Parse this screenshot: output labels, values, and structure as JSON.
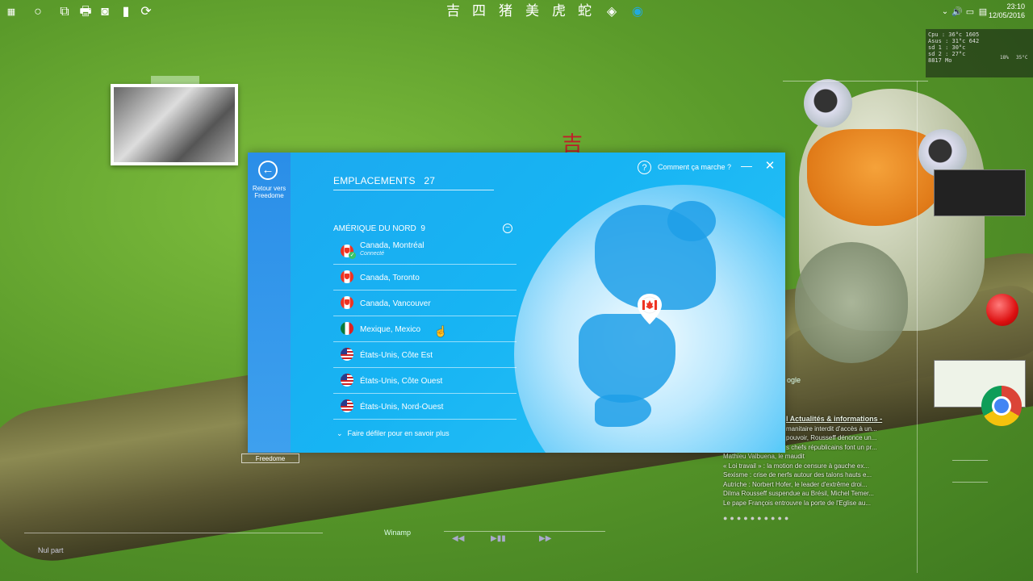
{
  "taskbar": {
    "chinese_chars": [
      "吉",
      "四",
      "猪",
      "美",
      "虎",
      "蛇"
    ],
    "time": "23:10",
    "date": "12/05/2016"
  },
  "sysmon": {
    "lines": [
      "Cpu : 36°c   1605",
      "Asus : 31°c   642",
      "sd 1 : 30°c",
      "sd 2 : 27°c",
      "8817 Mo"
    ],
    "temps": [
      "18%",
      "35°C"
    ]
  },
  "app": {
    "back_label": "Retour vers Freedome",
    "help_label": "Comment ça marche ?",
    "locations_title": "EMPLACEMENTS",
    "locations_count": "27",
    "region_name": "AMÉRIQUE DU NORD",
    "region_count": "9",
    "locations": [
      {
        "name": "Canada, Montréal",
        "status": "Connecté",
        "flag": "ca"
      },
      {
        "name": "Canada, Toronto",
        "flag": "ca"
      },
      {
        "name": "Canada, Vancouver",
        "flag": "ca"
      },
      {
        "name": "Mexique, Mexico",
        "flag": "mx"
      },
      {
        "name": "États-Unis, Côte Est",
        "flag": "us"
      },
      {
        "name": "États-Unis, Côte Ouest",
        "flag": "us"
      },
      {
        "name": "États-Unis, Nord-Ouest",
        "flag": "us"
      }
    ],
    "scroll_more": "Faire défiler pour en savoir plus",
    "accent_color": "#17b4f3"
  },
  "desktop": {
    "freedome_label": "Freedome",
    "winamp_label": "Winamp",
    "nul_part": "Nul part",
    "google_fragment": "ogle",
    "news_header": "l Actualités & informations -",
    "news_lines": [
      "manitaire interdit d'accès à un...",
      "pouvoir, Rousseff dénonce un...",
      "s chefs républicains font un pr...",
      "Mathieu Valbuena, le maudit",
      "« Loi travail » : la motion de censure à gauche ex...",
      "Sexisme : crise de nerfs autour des talons hauts e...",
      "Autriche : Norbert Hofer, le leader d'extrême droi...",
      "Dilma Rousseff suspendue au Brésil, Michel Temer...",
      "Le pape François entrouvre la porte de l'Eglise au..."
    ],
    "news_dots": "●●●●●●●●●●"
  }
}
